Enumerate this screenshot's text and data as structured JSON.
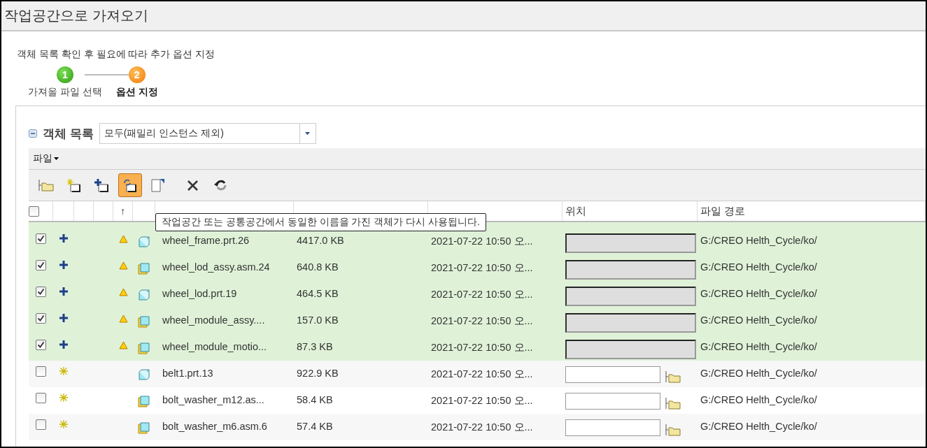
{
  "window": {
    "title": "작업공간으로 가져오기"
  },
  "instruction": "객체 목록 확인 후 필요에 따라 추가 옵션 지정",
  "steps": [
    {
      "number": "1",
      "label": "가져올 파일 선택",
      "selected": false
    },
    {
      "number": "2",
      "label": "옵션 지정",
      "selected": true
    }
  ],
  "object_list": {
    "title": "객체 목록",
    "expanded": true,
    "filter": "모두(패밀리 인스턴스 제외)"
  },
  "menu": {
    "label": "파일"
  },
  "toolbar": [
    {
      "kind": "folder",
      "selected": false
    },
    {
      "kind": "new",
      "selected": false
    },
    {
      "kind": "add",
      "selected": false
    },
    {
      "kind": "reuse",
      "selected": true
    },
    {
      "kind": "page",
      "selected": false
    },
    {
      "kind": "delete",
      "selected": false
    },
    {
      "kind": "undo",
      "selected": false
    }
  ],
  "table": {
    "select_all": {
      "checked": false
    },
    "columns": [
      "↑",
      "위치",
      "파일 경로"
    ],
    "tooltip": "작업공간 또는 공통공간에서 동일한 이름을 가진 객체가 다시 사용됩니다.",
    "rows": [
      {
        "checked": true,
        "new": false,
        "warning": true,
        "assembly": false,
        "name": "wheel_frame.prt.26",
        "size": "4417.0 KB",
        "modified": "2021-07-22 10:50 오...",
        "location_disabled": true,
        "path": "G:/CREO Helth_Cycle/ko/"
      },
      {
        "checked": true,
        "new": false,
        "warning": true,
        "assembly": true,
        "name": "wheel_lod_assy.asm.24",
        "size": "640.8 KB",
        "modified": "2021-07-22 10:50 오...",
        "location_disabled": true,
        "path": "G:/CREO Helth_Cycle/ko/"
      },
      {
        "checked": true,
        "new": false,
        "warning": true,
        "assembly": false,
        "name": "wheel_lod.prt.19",
        "size": "464.5 KB",
        "modified": "2021-07-22 10:50 오...",
        "location_disabled": true,
        "path": "G:/CREO Helth_Cycle/ko/"
      },
      {
        "checked": true,
        "new": false,
        "warning": true,
        "assembly": true,
        "name": "wheel_module_assy....",
        "size": "157.0 KB",
        "modified": "2021-07-22 10:50 오...",
        "location_disabled": true,
        "path": "G:/CREO Helth_Cycle/ko/"
      },
      {
        "checked": true,
        "new": false,
        "warning": true,
        "assembly": true,
        "name": "wheel_module_motio...",
        "size": "87.3 KB",
        "modified": "2021-07-22 10:50 오...",
        "location_disabled": true,
        "path": "G:/CREO Helth_Cycle/ko/"
      },
      {
        "checked": false,
        "new": true,
        "warning": false,
        "assembly": false,
        "name": "belt1.prt.13",
        "size": "922.9 KB",
        "modified": "2021-07-22 10:50 오...",
        "location_disabled": false,
        "path": "G:/CREO Helth_Cycle/ko/"
      },
      {
        "checked": false,
        "new": true,
        "warning": false,
        "assembly": true,
        "name": "bolt_washer_m12.as...",
        "size": "58.4 KB",
        "modified": "2021-07-22 10:50 오...",
        "location_disabled": false,
        "path": "G:/CREO Helth_Cycle/ko/"
      },
      {
        "checked": false,
        "new": true,
        "warning": false,
        "assembly": true,
        "name": "bolt_washer_m6.asm.6",
        "size": "57.4 KB",
        "modified": "2021-07-22 10:50 오...",
        "location_disabled": false,
        "path": "G:/CREO Helth_Cycle/ko/"
      }
    ]
  }
}
